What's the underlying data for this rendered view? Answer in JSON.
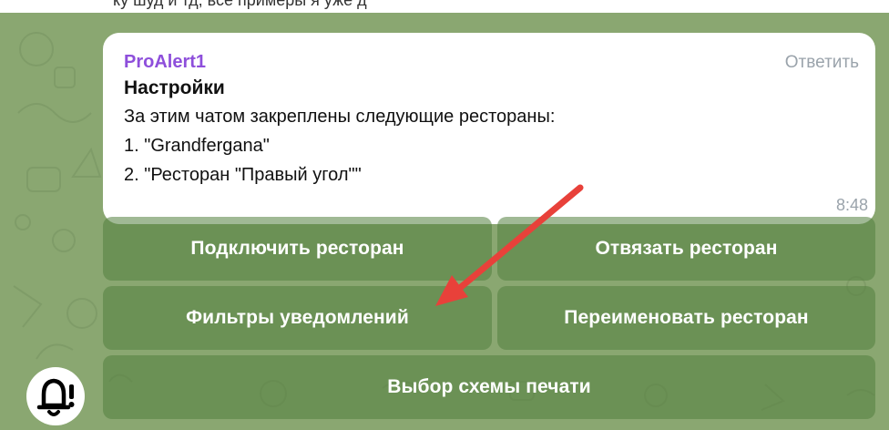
{
  "caption": "ку шуд и тд, все примеры я уже д",
  "message": {
    "sender": "ProAlert1",
    "reply_label": "Ответить",
    "title": "Настройки",
    "lines": [
      "За этим чатом закреплены следующие рестораны:",
      "1. \"Grandfergana\"",
      "2. \"Ресторан \"Правый угол\"\""
    ],
    "time": "8:48"
  },
  "keyboard": {
    "connect": "Подключить ресторан",
    "unlink": "Отвязать ресторан",
    "filters": "Фильтры уведомлений",
    "rename": "Переименовать ресторан",
    "print_scheme": "Выбор схемы печати"
  },
  "colors": {
    "chat_background": "#8aa771",
    "sender": "#8e4fdb",
    "arrow": "#e8413a"
  },
  "icons": {
    "bot_avatar": "bell-alert-icon",
    "annotation": "red-arrow"
  }
}
